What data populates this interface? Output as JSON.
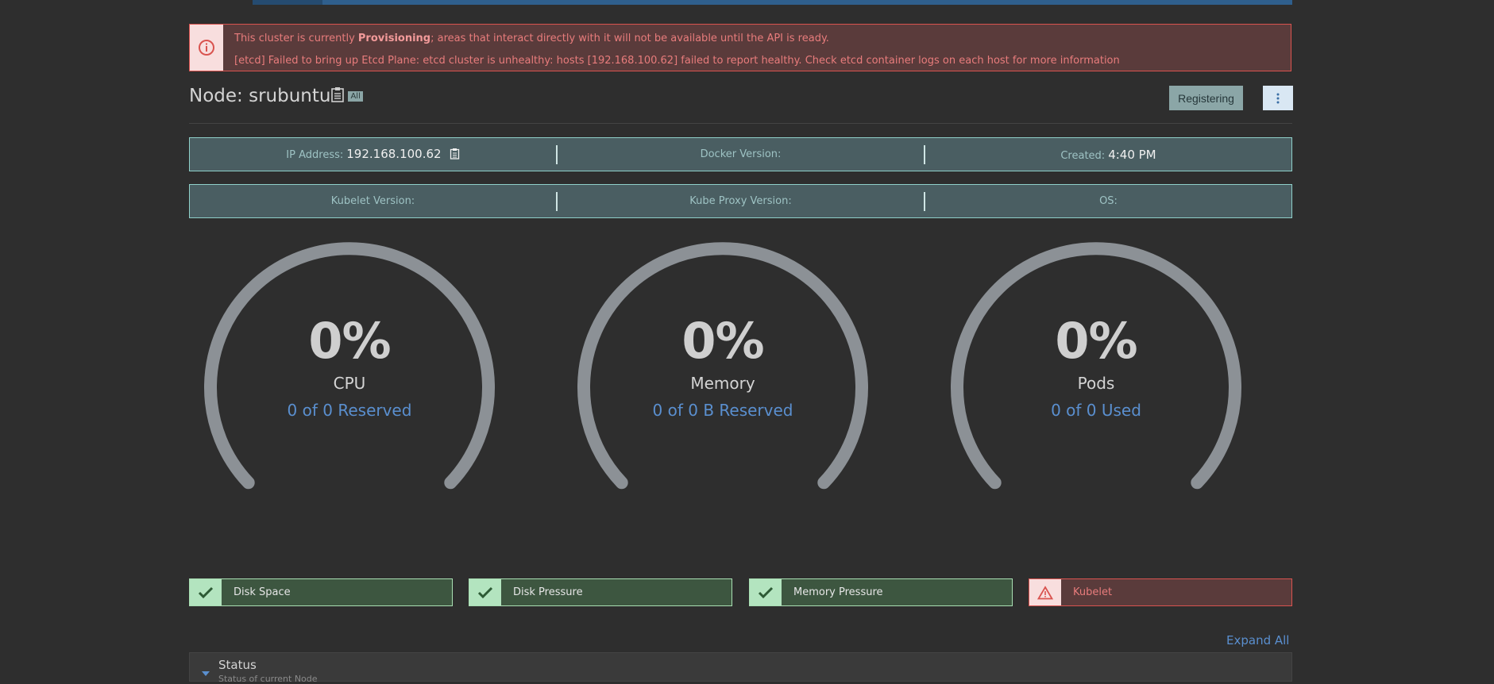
{
  "banner": {
    "line1_prefix": "This cluster is currently ",
    "line1_state": "Provisioning",
    "line1_suffix": "; areas that interact directly with it will not be available until the API is ready.",
    "line2": "[etcd] Failed to bring up Etcd Plane: etcd cluster is unhealthy: hosts [192.168.100.62] failed to report healthy. Check etcd container logs on each host for more information"
  },
  "header": {
    "title": "Node: srubuntu",
    "badge": "All",
    "state": "Registering"
  },
  "info_row1": {
    "ip_label": "IP Address:",
    "ip_value": "192.168.100.62",
    "docker_label": "Docker Version:",
    "created_label": "Created:",
    "created_value": "4:40 PM"
  },
  "info_row2": {
    "kubelet_label": "Kubelet Version:",
    "kubeproxy_label": "Kube Proxy Version:",
    "os_label": "OS:"
  },
  "gauges": [
    {
      "percent": "0%",
      "label": "CPU",
      "sub": "0 of 0 Reserved",
      "value": 0
    },
    {
      "percent": "0%",
      "label": "Memory",
      "sub": "0 of 0 B Reserved",
      "value": 0
    },
    {
      "percent": "0%",
      "label": "Pods",
      "sub": "0 of 0 Used",
      "value": 0
    }
  ],
  "conditions": [
    {
      "label": "Disk Space",
      "status": "ok"
    },
    {
      "label": "Disk Pressure",
      "status": "ok"
    },
    {
      "label": "Memory Pressure",
      "status": "ok"
    },
    {
      "label": "Kubelet",
      "status": "error"
    }
  ],
  "expand_all": "Expand All",
  "status_panel": {
    "title": "Status",
    "subtitle": "Status of current Node"
  },
  "icons": {
    "banner": "info-circle-icon",
    "copy": "clipboard-icon",
    "more": "vertical-ellipsis-icon",
    "ok": "checkmark-icon",
    "error": "warning-triangle-icon",
    "chevron": "chevron-down-icon"
  },
  "colors": {
    "background": "#2e2e2e",
    "error": "#d9534f",
    "success": "#a9dfb3",
    "link": "#5a8fcf",
    "gauge_track": "#8c9196"
  }
}
